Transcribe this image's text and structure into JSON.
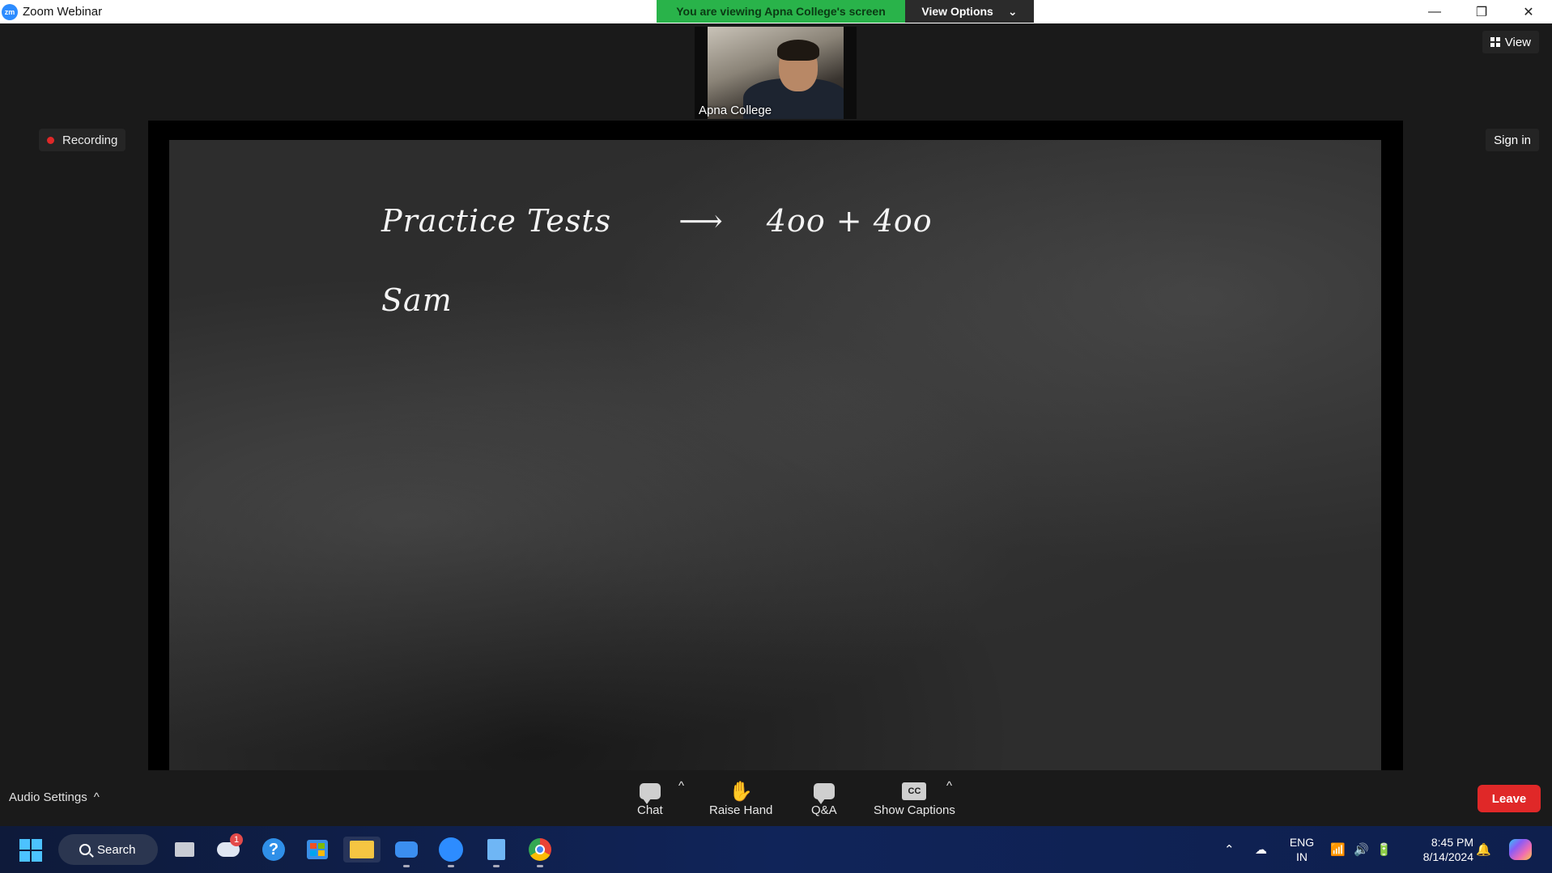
{
  "window": {
    "app_title": "Zoom Webinar",
    "logo_text": "zm",
    "controls": {
      "minimize": "—",
      "restore": "❐",
      "close": "✕"
    }
  },
  "share_banner": {
    "viewing_text": "You are viewing Apna College's screen",
    "view_options_label": "View Options",
    "chevron": "⌄"
  },
  "stage": {
    "thumbnail_name": "Apna College",
    "view_label": "View",
    "recording_label": "Recording",
    "signin_label": "Sign in",
    "board_line1": {
      "left": "Practice  Tests",
      "arrow": "⟶",
      "right": "4oo + 4oo"
    },
    "board_line2": "Sam"
  },
  "toolbar": {
    "audio_settings_label": "Audio Settings",
    "caret": "^",
    "chat_label": "Chat",
    "raise_hand_label": "Raise Hand",
    "raise_hand_glyph": "✋",
    "qa_label": "Q&A",
    "captions_label": "Show Captions",
    "captions_glyph": "CC",
    "leave_label": "Leave"
  },
  "taskbar": {
    "search_label": "Search",
    "weather_badge": "1",
    "language": "ENG",
    "region": "IN",
    "time": "8:45 PM",
    "date": "8/14/2024",
    "tray_caret": "⌃"
  },
  "colors": {
    "share_green": "#29b34a",
    "leave_red": "#e02828",
    "zoom_blue": "#2d8cff",
    "stage_bg": "#1a1a1a"
  }
}
